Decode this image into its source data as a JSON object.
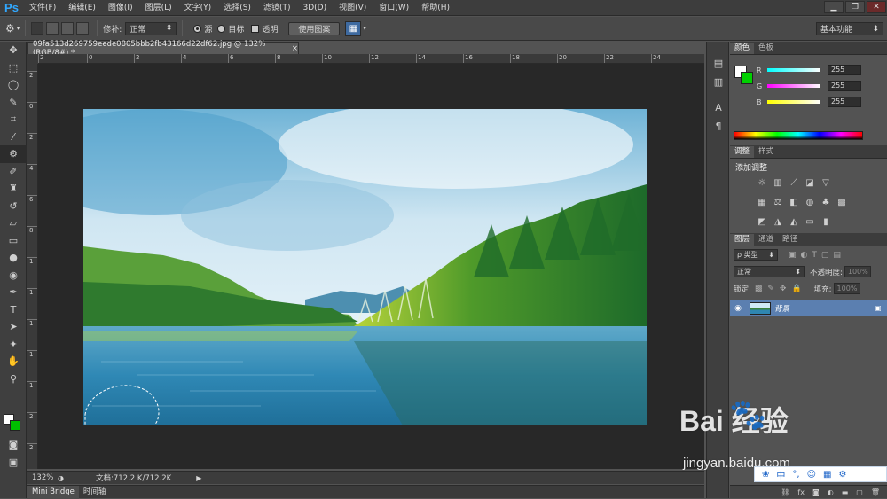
{
  "app": {
    "logo": "Ps"
  },
  "menu": [
    "文件(F)",
    "编辑(E)",
    "图像(I)",
    "图层(L)",
    "文字(Y)",
    "选择(S)",
    "滤镜(T)",
    "3D(D)",
    "视图(V)",
    "窗口(W)",
    "帮助(H)"
  ],
  "window_buttons": {
    "minimize": "▁",
    "restore": "❐",
    "close": "✕"
  },
  "options": {
    "patch_label": "修补:",
    "patch_mode": "正常",
    "source_label": "源",
    "target_label": "目标",
    "transparent_label": "透明",
    "use_pattern_label": "使用图案",
    "workspace": "基本功能"
  },
  "document": {
    "tab_title": "09fa513d269759eede0805bbb2fb43166d22df62.jpg @ 132%(RGB/8#) *",
    "close": "×"
  },
  "ruler_h": [
    "2",
    "0",
    "2",
    "4",
    "6",
    "8",
    "10",
    "12",
    "14",
    "16",
    "18",
    "20",
    "22",
    "24"
  ],
  "ruler_v": [
    "2",
    "0",
    "2",
    "4",
    "6",
    "8",
    "1",
    "1",
    "1",
    "1",
    "1",
    "2",
    "2"
  ],
  "status": {
    "zoom": "132%",
    "doc_size": "文档:712.2 K/712.2K"
  },
  "bottom_tabs": [
    "Mini Bridge",
    "时间轴"
  ],
  "color_panel": {
    "tabs": [
      "颜色",
      "色板"
    ],
    "channels": [
      {
        "label": "R",
        "value": "255",
        "gradient": "linear-gradient(to right,#00ffff,#ffffff)"
      },
      {
        "label": "G",
        "value": "255",
        "gradient": "linear-gradient(to right,#ff00ff,#ffffff)"
      },
      {
        "label": "B",
        "value": "255",
        "gradient": "linear-gradient(to right,#ffff00,#ffffff)"
      }
    ],
    "foreground": "#ffffff",
    "background": "#00d000"
  },
  "adjust_panel": {
    "tabs": [
      "调整",
      "样式"
    ],
    "title": "添加调整"
  },
  "layers_panel": {
    "tabs": [
      "图层",
      "通道",
      "路径"
    ],
    "filter_label": "ρ 类型",
    "blend_mode": "正常",
    "opacity_label": "不透明度:",
    "opacity_value": "100%",
    "lock_label": "锁定:",
    "fill_label": "填充:",
    "fill_value": "100%",
    "layer_name": "背景"
  },
  "watermark": {
    "logo_text": "Bai  经验",
    "url": "jingyan.baidu.com"
  },
  "ime": {
    "items": [
      "中",
      "°,",
      "☺",
      "▦",
      "⚙"
    ]
  }
}
